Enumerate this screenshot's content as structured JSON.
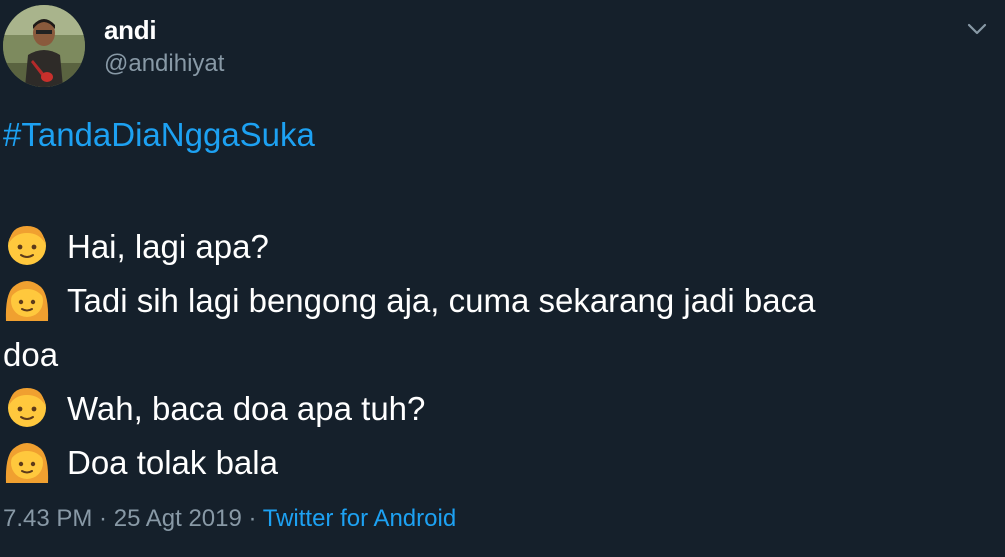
{
  "author": {
    "display_name": "andi",
    "handle": "@andihiyat"
  },
  "tweet": {
    "hashtag": "#TandaDiaNggaSuka",
    "lines": [
      {
        "speaker": "boy",
        "text": "Hai, lagi apa?"
      },
      {
        "speaker": "girl",
        "text": "Tadi sih lagi bengong aja, cuma sekarang jadi baca"
      },
      {
        "speaker": "none",
        "text": "doa"
      },
      {
        "speaker": "boy",
        "text": "Wah, baca doa apa tuh?"
      },
      {
        "speaker": "girl",
        "text": "Doa tolak bala"
      }
    ]
  },
  "meta": {
    "time": "7.43 PM",
    "sep1": " · ",
    "date": "25 Agt 2019",
    "sep2": " · ",
    "source": "Twitter for Android"
  },
  "icons": {
    "boy": "boy-emoji-icon",
    "girl": "girl-emoji-icon",
    "caret": "chevron-down-icon"
  },
  "colors": {
    "background": "#15202b",
    "text": "#ffffff",
    "muted": "#8899a6",
    "link": "#1da1f2",
    "emoji_skin": "#ffc83d",
    "emoji_hair": "#f2a23c"
  }
}
